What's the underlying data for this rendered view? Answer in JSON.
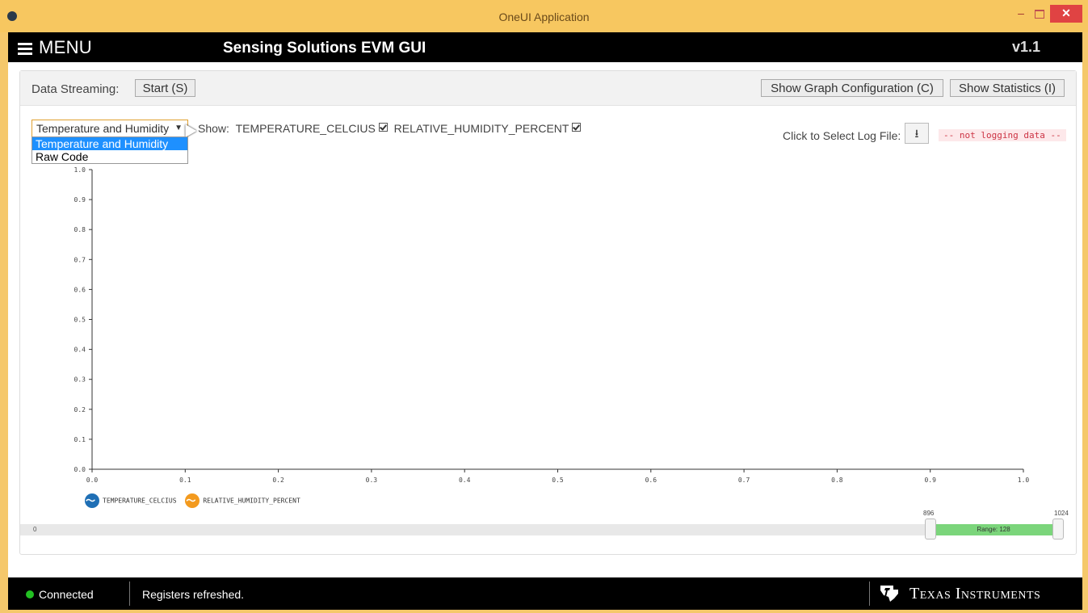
{
  "window": {
    "title": "OneUI Application",
    "minimize": "–",
    "close": "✕"
  },
  "appbar": {
    "menu_label": "MENU",
    "title": "Sensing Solutions EVM GUI",
    "version": "v1.1"
  },
  "toolbar": {
    "data_streaming_label": "Data Streaming:",
    "start_label": "Start (S)",
    "graph_config_label": "Show Graph Configuration (C)",
    "statistics_label": "Show Statistics (I)"
  },
  "graph_select": {
    "value": "Temperature and Humidity",
    "options": [
      "Temperature and Humidity",
      "Raw Code"
    ]
  },
  "show": {
    "label": "Show:",
    "series": [
      "TEMPERATURE_CELCIUS",
      "RELATIVE_HUMIDITY_PERCENT"
    ],
    "checked": [
      true,
      true
    ]
  },
  "log": {
    "label": "Click to Select Log File:",
    "status": "-- not logging data --",
    "icon": "download-icon"
  },
  "chart_data": {
    "type": "line",
    "x_ticks": [
      "0.0",
      "0.1",
      "0.2",
      "0.3",
      "0.4",
      "0.5",
      "0.6",
      "0.7",
      "0.8",
      "0.9",
      "1.0"
    ],
    "y_ticks": [
      "0.0",
      "0.1",
      "0.2",
      "0.3",
      "0.4",
      "0.5",
      "0.6",
      "0.7",
      "0.8",
      "0.9",
      "1.0"
    ],
    "xlim": [
      0,
      1
    ],
    "ylim": [
      0,
      1
    ],
    "grid": false,
    "legend_position": "bottom-left",
    "series": [
      {
        "name": "TEMPERATURE_CELCIUS",
        "color": "#1f6fb5",
        "values": []
      },
      {
        "name": "RELATIVE_HUMIDITY_PERCENT",
        "color": "#f39a1e",
        "values": []
      }
    ]
  },
  "range_slider": {
    "min_label": "0",
    "low": 896,
    "high": 1024,
    "low_label": "896",
    "high_label": "1024",
    "range_label": "Range: 128"
  },
  "statusbar": {
    "connection": "Connected",
    "message": "Registers refreshed.",
    "brand": "Texas Instruments"
  },
  "colors": {
    "accent": "#f7c760",
    "bar": "#000000",
    "connected": "#22c022"
  }
}
